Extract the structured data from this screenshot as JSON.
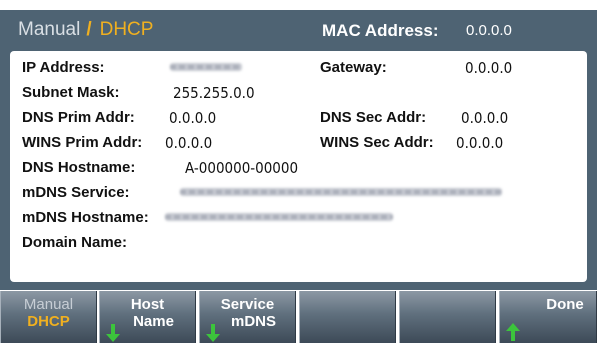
{
  "header": {
    "mode_label": "Manual",
    "separator": "/",
    "mode_active": "DHCP",
    "mac_label": "MAC Address:",
    "mac_value": "0.0.0.0"
  },
  "fields": {
    "ip_address_label": "IP Address:",
    "gateway_label": "Gateway:",
    "gateway_value": "0.0.0.0",
    "subnet_mask_label": "Subnet Mask:",
    "subnet_mask_value": "255.255.0.0",
    "dns_prim_label": "DNS Prim Addr:",
    "dns_prim_value": "0.0.0.0",
    "dns_sec_label": "DNS Sec Addr:",
    "dns_sec_value": "0.0.0.0",
    "wins_prim_label": "WINS Prim Addr:",
    "wins_prim_value": "0.0.0.0",
    "wins_sec_label": "WINS Sec Addr:",
    "wins_sec_value": "0.0.0.0",
    "dns_hostname_label": "DNS Hostname:",
    "dns_hostname_value": "A-000000-00000",
    "mdns_service_label": "mDNS Service:",
    "mdns_hostname_label": "mDNS Hostname:",
    "domain_name_label": "Domain Name:"
  },
  "softkeys": {
    "k1_line1": "Manual",
    "k1_line2": "DHCP",
    "k2_line1": "Host",
    "k2_line2": "Name",
    "k3_line1": "Service",
    "k3_line2": "mDNS",
    "k6_label": "Done"
  },
  "colors": {
    "screen_bg": "#4e6373",
    "accent": "#f0b020",
    "arrow_green": "#3cc43c"
  }
}
